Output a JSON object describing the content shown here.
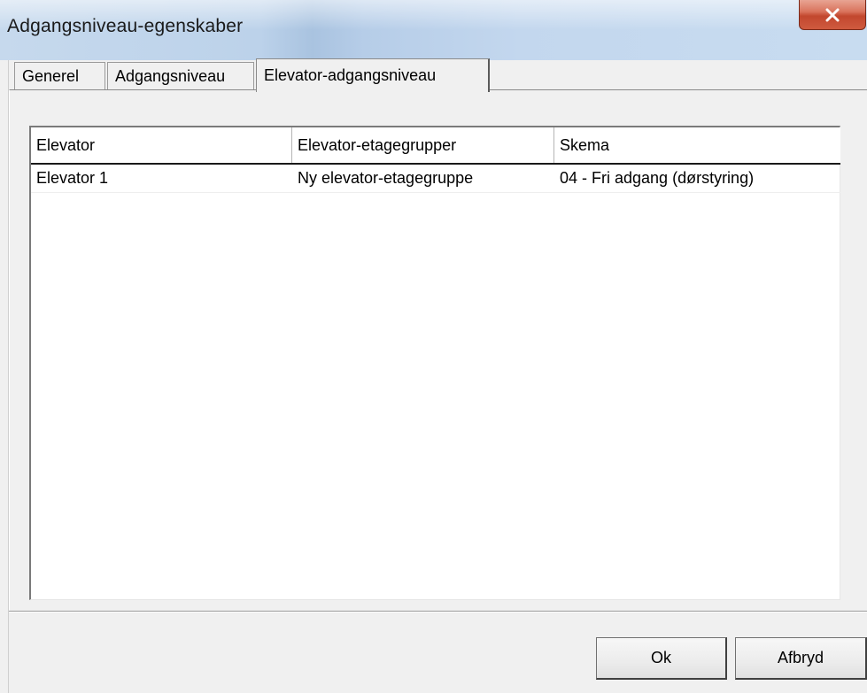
{
  "window": {
    "title": "Adgangsniveau-egenskaber",
    "close_icon": "close-icon"
  },
  "tabs": [
    {
      "label": "Generel",
      "active": false
    },
    {
      "label": "Adgangsniveau",
      "active": false
    },
    {
      "label": "Elevator-adgangsniveau",
      "active": true
    }
  ],
  "list": {
    "columns": [
      "Elevator",
      "Elevator-etagegrupper",
      "Skema"
    ],
    "rows": [
      [
        "Elevator 1",
        "Ny elevator-etagegruppe",
        "04 - Fri adgang (dørstyring)"
      ]
    ]
  },
  "buttons": {
    "ok": "Ok",
    "cancel": "Afbryd"
  },
  "colors": {
    "close_button": "#c9533a",
    "window_background": "#f0f0f0"
  }
}
